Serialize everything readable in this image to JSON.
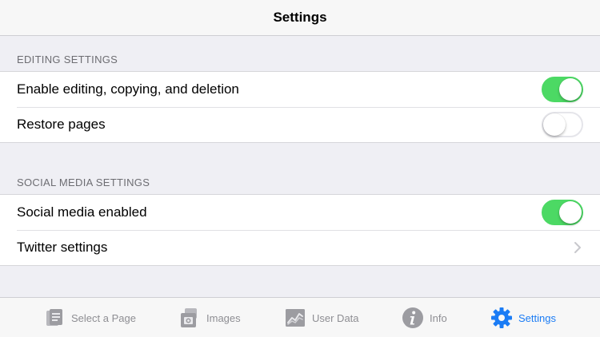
{
  "navbar": {
    "title": "Settings"
  },
  "sections": {
    "editing": {
      "header": "EDITING SETTINGS",
      "rows": [
        {
          "label": "Enable editing, copying, and deletion",
          "control": "toggle",
          "on": true
        },
        {
          "label": "Restore pages",
          "control": "toggle",
          "on": false
        }
      ]
    },
    "social": {
      "header": "SOCIAL MEDIA SETTINGS",
      "rows": [
        {
          "label": "Social media enabled",
          "control": "toggle",
          "on": true
        },
        {
          "label": "Twitter settings",
          "control": "chevron-right-icon"
        }
      ]
    }
  },
  "tabbar": {
    "tabs": [
      {
        "label": "Select a Page",
        "icon": "page-icon",
        "active": false
      },
      {
        "label": "Images",
        "icon": "images-icon",
        "active": false
      },
      {
        "label": "User Data",
        "icon": "chart-icon",
        "active": false
      },
      {
        "label": "Info",
        "icon": "info-icon",
        "active": false
      },
      {
        "label": "Settings",
        "icon": "gear-icon",
        "active": true
      }
    ]
  },
  "colors": {
    "toggle_on": "#4cd964",
    "tint": "#1b7cf5",
    "inactive": "#8e8e93",
    "background": "#efeff4"
  }
}
